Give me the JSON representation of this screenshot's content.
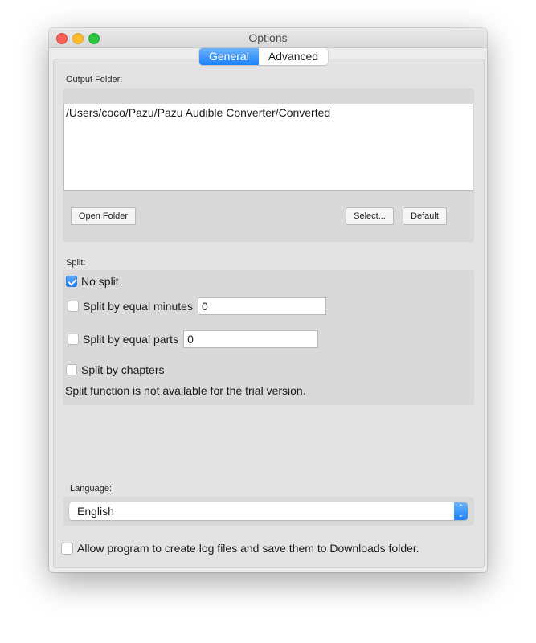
{
  "window": {
    "title": "Options",
    "controls": [
      "close",
      "minimize",
      "maximize"
    ]
  },
  "tabs": [
    {
      "label": "General",
      "active": true
    },
    {
      "label": "Advanced",
      "active": false
    }
  ],
  "output_folder": {
    "label": "Output Folder:",
    "path": "/Users/coco/Pazu/Pazu Audible Converter/Converted",
    "open_button": "Open Folder",
    "select_button": "Select...",
    "default_button": "Default"
  },
  "split": {
    "label": "Split:",
    "options": [
      {
        "label": "No split",
        "checked": true
      },
      {
        "label": "Split by equal minutes",
        "checked": false,
        "value": "0"
      },
      {
        "label": "Split by equal parts",
        "checked": false,
        "value": "0"
      },
      {
        "label": "Split by chapters",
        "checked": false
      }
    ],
    "note": "Split function is not available for the trial version."
  },
  "language": {
    "label": "Language:",
    "selected": "English",
    "arrows": {
      "up": "⌃",
      "down": "⌄"
    }
  },
  "log_option": {
    "label": "Allow program to create log files and save them to Downloads folder.",
    "checked": false
  },
  "colors": {
    "accent": "#1a82fb",
    "window_bg": "#ececec",
    "group_bg": "#d9d9d9"
  }
}
